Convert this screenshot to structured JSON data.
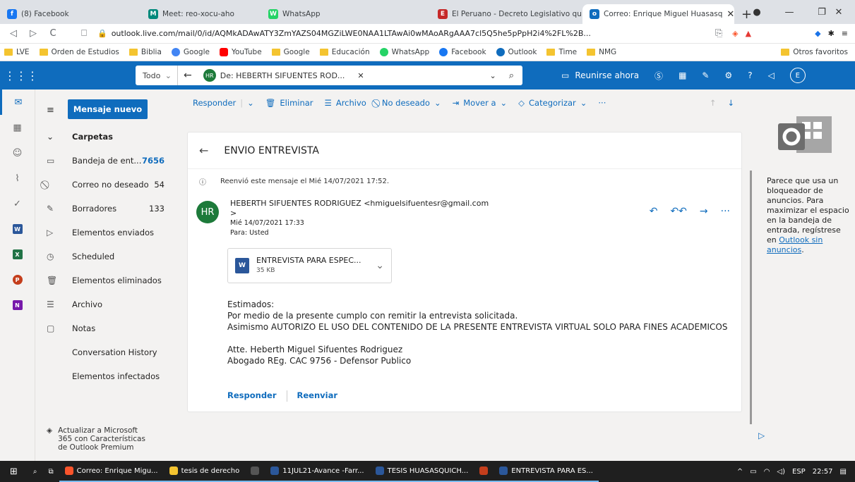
{
  "browser": {
    "tabs": [
      {
        "label": "(8) Facebook",
        "icon": "facebook-icon",
        "color": "#1877f2",
        "glyph": "f"
      },
      {
        "label": "Meet: reo-xocu-aho",
        "icon": "meet-icon",
        "color": "#00897b",
        "glyph": "M"
      },
      {
        "label": "WhatsApp",
        "icon": "whatsapp-icon",
        "color": "#25d366",
        "glyph": "W"
      },
      {
        "label": "El Peruano - Decreto Legislativo qu",
        "icon": "peruano-icon",
        "color": "#c62828",
        "glyph": "E"
      },
      {
        "label": "Correo: Enrique Miguel Huasasq",
        "icon": "outlook-icon",
        "color": "#0f6cbd",
        "glyph": "o"
      }
    ],
    "url": "outlook.live.com/mail/0/id/AQMkADAwATY3ZmYAZS04MGZiLWE0NAA1LTAwAi0wMAoARgAAA7cl5Q5he5pPpH2i4%2FL%2B...",
    "bookmarks": [
      {
        "label": "LVE",
        "type": "folder"
      },
      {
        "label": "Orden de Estudios",
        "type": "folder"
      },
      {
        "label": "Biblia",
        "type": "folder"
      },
      {
        "label": "Google",
        "type": "google"
      },
      {
        "label": "YouTube",
        "type": "youtube"
      },
      {
        "label": "Google",
        "type": "folder"
      },
      {
        "label": "Educación",
        "type": "folder"
      },
      {
        "label": "WhatsApp",
        "type": "whatsapp"
      },
      {
        "label": "Facebook",
        "type": "facebook"
      },
      {
        "label": "Outlook",
        "type": "outlook"
      },
      {
        "label": "Time",
        "type": "folder"
      },
      {
        "label": "NMG",
        "type": "folder"
      }
    ],
    "other_favorites": "Otros favoritos"
  },
  "outlook": {
    "search_scope": "Todo",
    "search_chip": "De: HEBERTH SIFUENTES ROD...",
    "chip_initials": "HR",
    "meet_now": "Reunirse ahora",
    "new_message": "Mensaje nuevo",
    "folders_heading": "Carpetas",
    "folders": [
      {
        "label": "Bandeja de ent...",
        "count": "7656",
        "bold": true,
        "icon": "inbox-icon",
        "glyph": "▭"
      },
      {
        "label": "Correo no deseado",
        "count": "54",
        "bold": false,
        "icon": "junk-icon",
        "glyph": "⃠"
      },
      {
        "label": "Borradores",
        "count": "133",
        "bold": false,
        "icon": "pencil-icon",
        "glyph": "✎"
      },
      {
        "label": "Elementos enviados",
        "count": "",
        "bold": false,
        "icon": "send-icon",
        "glyph": "▷"
      },
      {
        "label": "Scheduled",
        "count": "",
        "bold": false,
        "icon": "clock-icon",
        "glyph": "◷"
      },
      {
        "label": "Elementos eliminados",
        "count": "",
        "bold": false,
        "icon": "trash-icon",
        "glyph": "🗑"
      },
      {
        "label": "Archivo",
        "count": "",
        "bold": false,
        "icon": "archive-icon",
        "glyph": "☰"
      },
      {
        "label": "Notas",
        "count": "",
        "bold": false,
        "icon": "note-icon",
        "glyph": "▢"
      },
      {
        "label": "Conversation History",
        "count": "",
        "bold": false,
        "icon": "",
        "glyph": ""
      },
      {
        "label": "Elementos infectados",
        "count": "",
        "bold": false,
        "icon": "",
        "glyph": ""
      }
    ],
    "upgrade_text_1": "Actualizar a Microsoft",
    "upgrade_text_2": "365 con Características",
    "upgrade_text_3": "de Outlook Premium",
    "toolbar": {
      "reply": "Responder",
      "delete": "Eliminar",
      "archive": "Archivo",
      "junk": "No deseado",
      "move": "Mover a",
      "categorize": "Categorizar"
    },
    "message": {
      "subject": "ENVIO ENTREVISTA",
      "forward_note": "Reenvió este mensaje el Mié 14/07/2021 17:52.",
      "sender_initials": "HR",
      "sender": "HEBERTH SIFUENTES RODRIGUEZ <hmiguelsifuentesr@gmail.com",
      "sender_tail": ">",
      "date": "Mié 14/07/2021 17:33",
      "to": "Para:  Usted",
      "attachment_name": "ENTREVISTA PARA ESPEC...",
      "attachment_size": "35 KB",
      "body": [
        "Estimados:",
        "Por medio de la presente cumplo con remitir la entrevista solicitada.",
        "Asimismo AUTORIZO EL USO DEL CONTENIDO DE LA PRESENTE ENTREVISTA VIRTUAL SOLO PARA FINES ACADEMICOS",
        "",
        "Atte. Heberth Miguel Sifuentes Rodriguez",
        "Abogado REg. CAC 9756 - Defensor Publico"
      ],
      "reply_link": "Responder",
      "forward_link": "Reenviar"
    },
    "ad": {
      "text": "Parece que usa un bloqueador de anuncios. Para maximizar el espacio en la bandeja de entrada, regístrese en ",
      "link": "Outlook sin anuncios",
      "end": "."
    }
  },
  "taskbar": {
    "items": [
      {
        "label": "Correo: Enrique Migu...",
        "icon": "brave-icon",
        "color": "#fb542b"
      },
      {
        "label": "tesis de derecho",
        "icon": "folder-icon",
        "color": "#f4c430"
      },
      {
        "label": "",
        "icon": "calculator-icon",
        "color": "#555555"
      },
      {
        "label": "11JUL21-Avance -Farr...",
        "icon": "word-icon",
        "color": "#2b579a"
      },
      {
        "label": "TESIS HUASASQUICH...",
        "icon": "word-icon",
        "color": "#2b579a"
      },
      {
        "label": "",
        "icon": "powerpoint-icon",
        "color": "#c43e1c"
      },
      {
        "label": "ENTREVISTA PARA ES...",
        "icon": "word-icon",
        "color": "#2b579a"
      }
    ],
    "lang": "ESP",
    "time": "22:57"
  }
}
